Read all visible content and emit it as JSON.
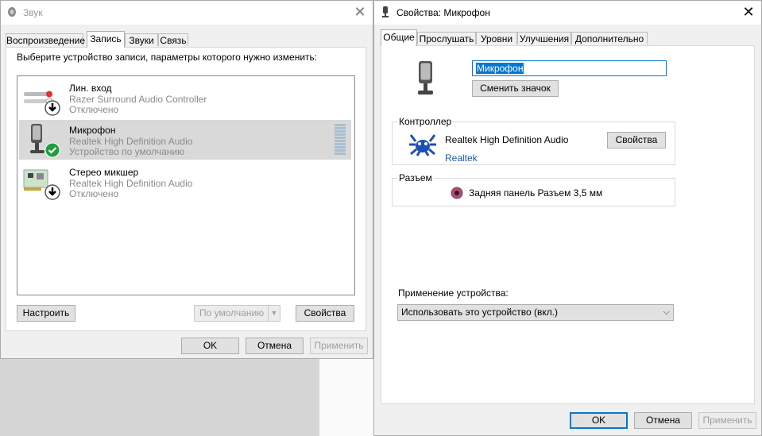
{
  "sound_window": {
    "title": "Звук",
    "tabs": [
      {
        "label": "Воспроизведение"
      },
      {
        "label": "Запись"
      },
      {
        "label": "Звуки"
      },
      {
        "label": "Связь"
      }
    ],
    "instruction": "Выберите устройство записи, параметры которого нужно изменить:",
    "devices": [
      {
        "name": "Лин. вход",
        "driver": "Razer Surround Audio Controller",
        "status": "Отключено",
        "icon": "line-in-icon",
        "badge": "disabled-arrow-icon"
      },
      {
        "name": "Микрофон",
        "driver": "Realtek High Definition Audio",
        "status": "Устройство по умолчанию",
        "icon": "microphone-icon",
        "badge": "default-check-icon"
      },
      {
        "name": "Стерео микшер",
        "driver": "Realtek High Definition Audio",
        "status": "Отключено",
        "icon": "sound-card-icon",
        "badge": "disabled-arrow-icon"
      }
    ],
    "buttons": {
      "configure": "Настроить",
      "set_default": "По умолчанию",
      "properties": "Свойства",
      "ok": "OK",
      "cancel": "Отмена",
      "apply": "Применить"
    }
  },
  "props_window": {
    "title": "Свойства: Микрофон",
    "tabs": [
      {
        "label": "Общие"
      },
      {
        "label": "Прослушать"
      },
      {
        "label": "Уровни"
      },
      {
        "label": "Улучшения"
      },
      {
        "label": "Дополнительно"
      }
    ],
    "device_name": "Микрофон",
    "change_icon": "Сменить значок",
    "controller": {
      "label": "Контроллер",
      "name": "Realtek High Definition Audio",
      "link": "Realtek",
      "properties": "Свойства"
    },
    "jack": {
      "label": "Разъем",
      "text": "Задняя панель Разъем 3,5 мм",
      "color": "#c0457a"
    },
    "usage": {
      "label": "Применение устройства:",
      "value": "Использовать это устройство (вкл.)"
    },
    "buttons": {
      "ok": "OK",
      "cancel": "Отмена",
      "apply": "Применить"
    }
  },
  "colors": {
    "accent": "#0078d7",
    "link": "#1e5aa8",
    "selected_row": "#d9d9d9",
    "check_badge": "#1e9e3a"
  }
}
